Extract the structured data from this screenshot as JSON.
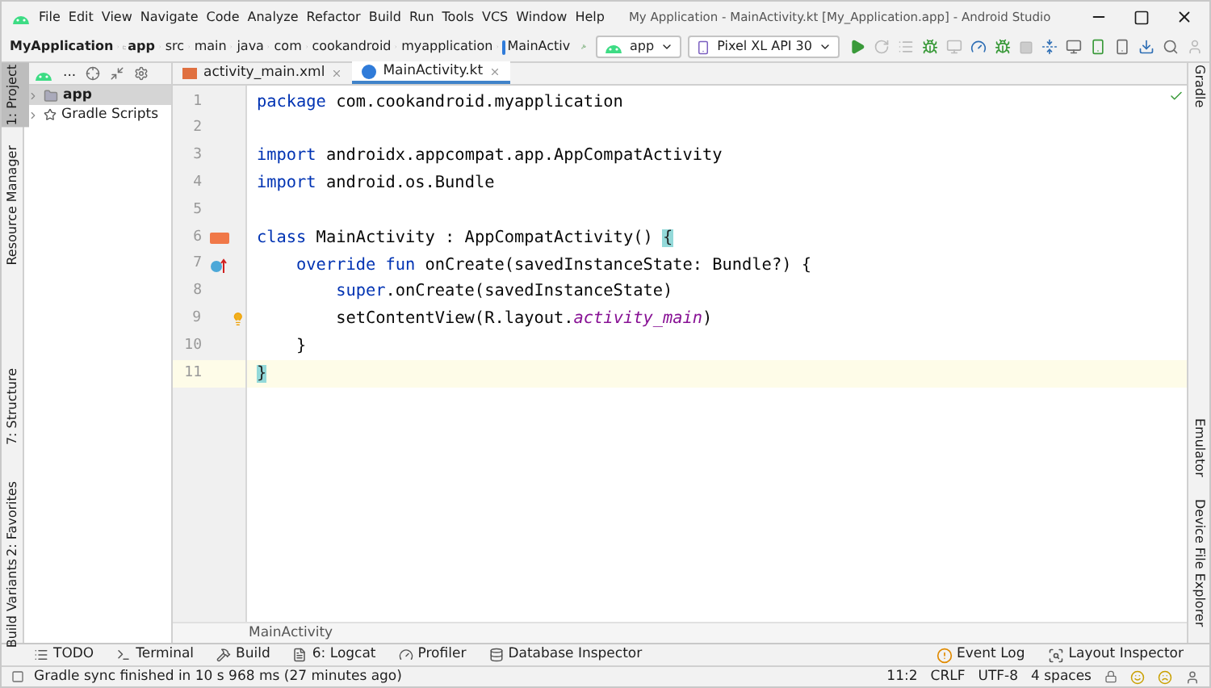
{
  "title_bar": {
    "menu": [
      "File",
      "Edit",
      "View",
      "Navigate",
      "Code",
      "Analyze",
      "Refactor",
      "Build",
      "Run",
      "Tools",
      "VCS",
      "Window",
      "Help"
    ],
    "title": "My Application - MainActivity.kt [My_Application.app] - Android Studio"
  },
  "navigation_bar": {
    "breadcrumbs": [
      {
        "label": "MyApplication",
        "kind": "project"
      },
      {
        "label": "app",
        "kind": "module"
      },
      {
        "label": "src",
        "kind": "folder"
      },
      {
        "label": "main",
        "kind": "folder"
      },
      {
        "label": "java",
        "kind": "folder"
      },
      {
        "label": "com",
        "kind": "folder"
      },
      {
        "label": "cookandroid",
        "kind": "folder"
      },
      {
        "label": "myapplication",
        "kind": "folder"
      },
      {
        "label": "MainActiv",
        "kind": "file"
      }
    ],
    "run_config": "app",
    "device": "Pixel XL API 30"
  },
  "left_tool_tabs": [
    {
      "label": "1: Project",
      "selected": true
    },
    {
      "label": "Resource Manager",
      "selected": false
    },
    {
      "label": "7: Structure",
      "selected": false
    },
    {
      "label": "2: Favorites",
      "selected": false
    },
    {
      "label": "Build Variants",
      "selected": false
    }
  ],
  "project_panel": {
    "view_label": "...",
    "tree": [
      {
        "label": "app",
        "selected": true,
        "kind": "module"
      },
      {
        "label": "Gradle Scripts",
        "selected": false,
        "kind": "gradle"
      }
    ]
  },
  "editor_tabs": [
    {
      "label": "activity_main.xml",
      "selected": false,
      "kind": "xml"
    },
    {
      "label": "MainActivity.kt",
      "selected": true,
      "kind": "kotlin"
    }
  ],
  "editor": {
    "lines": [
      {
        "number": "1",
        "current": false,
        "segments": [
          {
            "text": "package",
            "kind": "kw"
          },
          {
            "text": " com.cookandroid.myapplication",
            "kind": "text"
          }
        ]
      },
      {
        "number": "2",
        "current": false
      },
      {
        "number": "3",
        "current": false,
        "segments": [
          {
            "text": "import",
            "kind": "kw"
          },
          {
            "text": " androidx.appcompat.app.AppCompatActivity",
            "kind": "text"
          }
        ]
      },
      {
        "number": "4",
        "current": false,
        "segments": [
          {
            "text": "import",
            "kind": "kw"
          },
          {
            "text": " android.os.Bundle",
            "kind": "text"
          }
        ]
      },
      {
        "number": "5",
        "current": false
      },
      {
        "number": "6",
        "current": false,
        "layout_marker": true,
        "segments": [
          {
            "text": "class",
            "kind": "kw"
          },
          {
            "text": " MainActivity : AppCompatActivity() ",
            "kind": "text"
          },
          {
            "text": "{",
            "kind": "brace"
          }
        ]
      },
      {
        "number": "7",
        "current": false,
        "override_marker": true,
        "segments": [
          {
            "text": "    override fun",
            "kind": "kw"
          },
          {
            "text": " onCreate(savedInstanceState: Bundle?) {",
            "kind": "text"
          }
        ]
      },
      {
        "number": "8",
        "current": false,
        "segments": [
          {
            "text": "        super",
            "kind": "kw"
          },
          {
            "text": ".onCreate(savedInstanceState)",
            "kind": "text"
          }
        ]
      },
      {
        "number": "9",
        "current": false,
        "intention_bulb": true,
        "segments": [
          {
            "text": "        setContentView(R.layout.",
            "kind": "text"
          },
          {
            "text": "activity_main",
            "kind": "italic"
          },
          {
            "text": ")",
            "kind": "text"
          }
        ]
      },
      {
        "number": "10",
        "current": false,
        "segments": [
          {
            "text": "    }",
            "kind": "text"
          }
        ]
      },
      {
        "number": "11",
        "current": true,
        "segments": [
          {
            "text": "}",
            "kind": "brace"
          }
        ]
      }
    ],
    "breadcrumb": "MainActivity"
  },
  "right_tool_tabs": [
    {
      "label": "Gradle"
    },
    {
      "label": "Emulator"
    },
    {
      "label": "Device File Explorer"
    }
  ],
  "bottom_tool_tabs": [
    {
      "label": "TODO",
      "kind": "list"
    },
    {
      "label": "Terminal",
      "kind": "terminal"
    },
    {
      "label": "Build",
      "kind": "hammer"
    },
    {
      "label": "6: Logcat",
      "kind": "log"
    },
    {
      "label": "Profiler",
      "kind": "gauge"
    },
    {
      "label": "Database Inspector",
      "kind": "database"
    }
  ],
  "bottom_right_tabs": [
    {
      "label": "Event Log",
      "kind": "alert"
    },
    {
      "label": "Layout Inspector",
      "kind": "inspect"
    }
  ],
  "status_bar": {
    "message": "Gradle sync finished in 10 s 968 ms (27 minutes ago)",
    "position": "11:2",
    "line_separator": "CRLF",
    "encoding": "UTF-8",
    "indent": "4 spaces"
  }
}
